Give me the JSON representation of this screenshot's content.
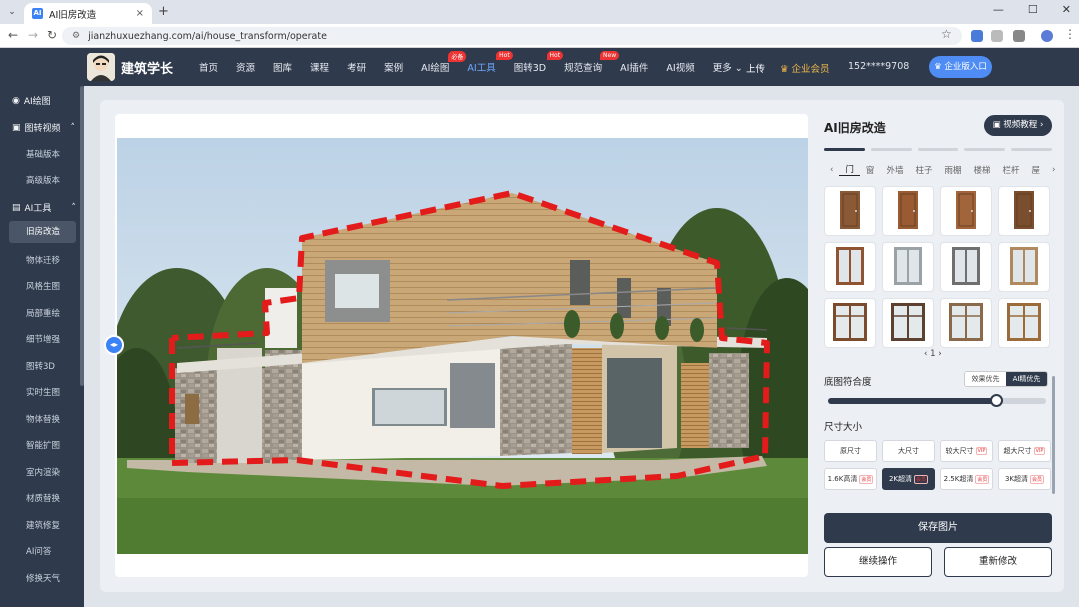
{
  "browser": {
    "tab_title": "AI旧房改造",
    "tab_icon": "AI",
    "url": "jianzhuxuezhang.com/ai/house_transform/operate",
    "new_tab": "+",
    "close": "×"
  },
  "header": {
    "brand": "建筑学长",
    "nav": [
      {
        "label": "首页"
      },
      {
        "label": "资源"
      },
      {
        "label": "图库"
      },
      {
        "label": "课程"
      },
      {
        "label": "考研"
      },
      {
        "label": "案例"
      },
      {
        "label": "AI绘图",
        "badge": "必备"
      },
      {
        "label": "AI工具",
        "badge": "Hot",
        "active": true
      },
      {
        "label": "图转3D",
        "badge": "Hot"
      },
      {
        "label": "规范查询",
        "badge": "New"
      },
      {
        "label": "AI插件"
      },
      {
        "label": "AI视频"
      },
      {
        "label": "更多"
      }
    ],
    "upload": "上传",
    "vip": "企业会员",
    "phone": "152****9708",
    "enterprise_btn": "企业版入口"
  },
  "sidebar": {
    "top": "AI绘图",
    "group1": "图转视频",
    "group1_items": [
      "基础版本",
      "高级版本"
    ],
    "group2": "AI工具",
    "group2_items": [
      "旧房改造",
      "物体迁移",
      "风格生图",
      "局部重绘",
      "细节增强",
      "图转3D",
      "实时生图",
      "物体替换",
      "智能扩图",
      "室内渲染",
      "材质替换",
      "建筑修复",
      "AI问答",
      "修换天气"
    ],
    "active": "旧房改造"
  },
  "panel": {
    "title": "AI旧房改造",
    "tutorial": "视频教程",
    "categories": [
      "门",
      "窗",
      "外墙",
      "柱子",
      "雨棚",
      "楼梯",
      "栏杆",
      "屋"
    ],
    "active_category": "门",
    "page": "1",
    "similarity_label": "底图符合度",
    "similarity_options": [
      "效果优先",
      "AI精优先"
    ],
    "similarity_selected": "AI精优先",
    "similarity_value": 0.77,
    "size_label": "尺寸大小",
    "sizes": [
      {
        "label": "原尺寸"
      },
      {
        "label": "大尺寸"
      },
      {
        "label": "较大尺寸",
        "tag": "VIP"
      },
      {
        "label": "超大尺寸",
        "tag": "VIP"
      },
      {
        "label": "1.6K高清",
        "tag": "会员"
      },
      {
        "label": "2K超清",
        "tag": "会员",
        "selected": true
      },
      {
        "label": "2.5K超清",
        "tag": "会员"
      },
      {
        "label": "3K超清",
        "tag": "会员"
      }
    ],
    "save": "保存图片",
    "continue": "继续操作",
    "redo": "重新修改"
  },
  "colors": {
    "dark": "#2f3a4c",
    "accent": "#3b82f6",
    "mask": "#e31b1b"
  }
}
